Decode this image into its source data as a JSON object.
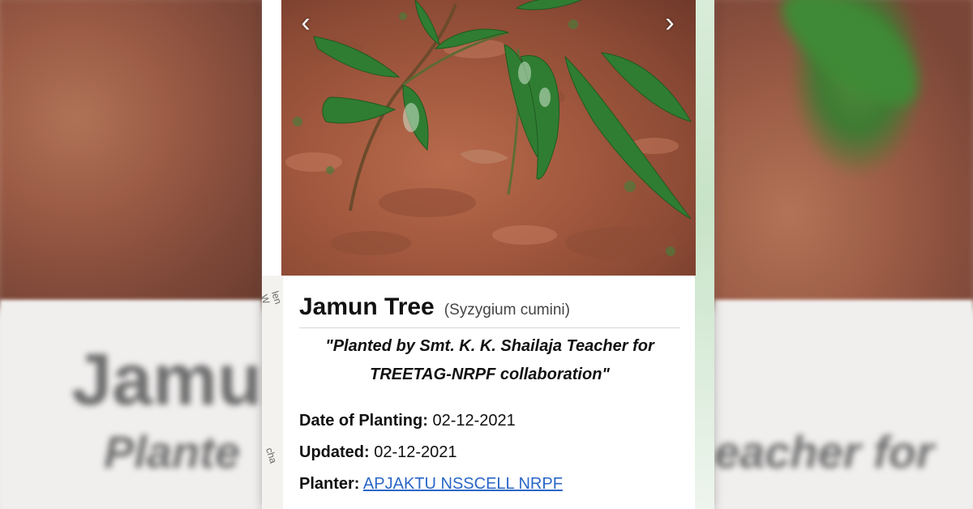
{
  "background": {
    "left_text_1": "Jamun",
    "left_text_2": "Plante",
    "right_text": "eacher for"
  },
  "map": {
    "label_1": "len W",
    "label_2": "cha"
  },
  "carousel": {
    "prev_icon": "‹",
    "next_icon": "›"
  },
  "tree": {
    "name": "Jamun Tree",
    "scientific_name": "(Syzygium cumini)",
    "dedication_line_1": "\"Planted by Smt. K. K. Shailaja Teacher for",
    "dedication_line_2": "TREETAG-NRPF collaboration\"",
    "date_label": "Date of Planting:",
    "date_value": "02-12-2021",
    "updated_label": "Updated:",
    "updated_value": "02-12-2021",
    "planter_label": "Planter:",
    "planter_value": "APJAKTU NSSCELL NRPF"
  },
  "colors": {
    "link": "#2a67c7",
    "soil": "#a45a3f",
    "leaf": "#3f8a36"
  }
}
